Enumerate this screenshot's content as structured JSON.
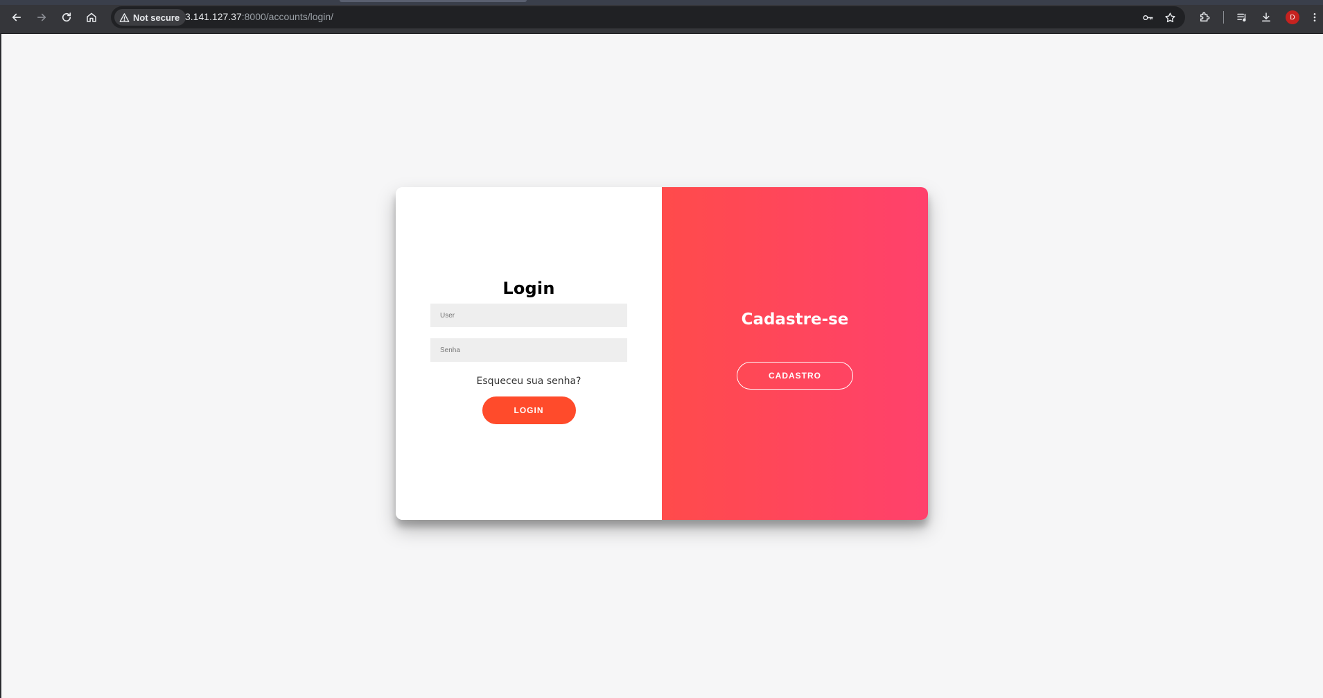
{
  "browser": {
    "security_label": "Not secure",
    "url_host": "3.141.127.37",
    "url_rest": ":8000/accounts/login/",
    "profile_initial": "D",
    "icons": {
      "back": "arrow-back-icon",
      "forward": "arrow-forward-icon",
      "reload": "reload-icon",
      "home": "home-icon",
      "warning": "warning-triangle-icon",
      "password_key": "key-icon",
      "bookmark": "star-icon",
      "extensions": "puzzle-icon",
      "media": "playlist-icon",
      "downloads": "download-icon",
      "menu": "kebab-menu-icon"
    }
  },
  "login": {
    "title": "Login",
    "user_placeholder": "User",
    "password_placeholder": "Senha",
    "forgot_password": "Esqueceu sua senha?",
    "submit_label": "LOGIN"
  },
  "signup": {
    "title": "Cadastre-se",
    "button_label": "CADASTRO"
  },
  "colors": {
    "accent": "#ff4b2b",
    "gradient_start": "#ff4b4b",
    "gradient_end": "#ff416c",
    "page_background": "#f6f6f7",
    "input_background": "#eeeeee"
  }
}
